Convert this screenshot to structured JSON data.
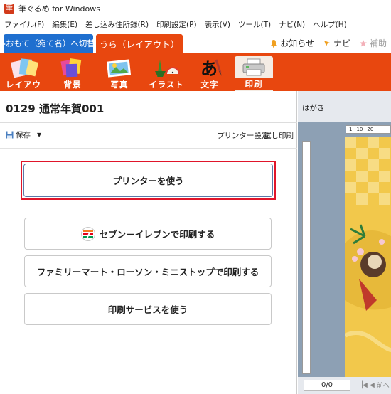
{
  "window": {
    "title": "筆ぐるめ for Windows"
  },
  "menu": [
    "ファイル(F)",
    "編集(E)",
    "差し込み住所録(R)",
    "印刷設定(P)",
    "表示(V)",
    "ツール(T)",
    "ナビ(N)",
    "ヘルプ(H)"
  ],
  "tabs": {
    "front": "▸おもて（宛て名）へ切替",
    "back": "うら（レイアウト）"
  },
  "top_links": {
    "notice": "お知らせ",
    "navi": "ナビ",
    "support": "補助"
  },
  "toolbar": {
    "layout": "レイアウト",
    "background": "背景",
    "photo": "写真",
    "illust": "イラスト",
    "text": "文字",
    "print": "印刷"
  },
  "doc": {
    "title": "0129 通常年賀001"
  },
  "actions": {
    "save": "保存",
    "printer_settings": "プリンター設定",
    "test_print": "試し印刷"
  },
  "options": {
    "use_printer": "プリンターを使う",
    "seven_eleven": "セブン－イレブンで印刷する",
    "familymart": "ファミリーマート・ローソン・ミニストップで印刷する",
    "print_service": "印刷サービスを使う"
  },
  "preview": {
    "label": "はがき",
    "ruler": [
      "1",
      "10",
      "20"
    ],
    "page_count": "0/0",
    "prev": "前へ"
  },
  "colors": {
    "accent": "#e8470f",
    "front_tab": "#1f6fcf",
    "highlight": "#e0152a"
  }
}
